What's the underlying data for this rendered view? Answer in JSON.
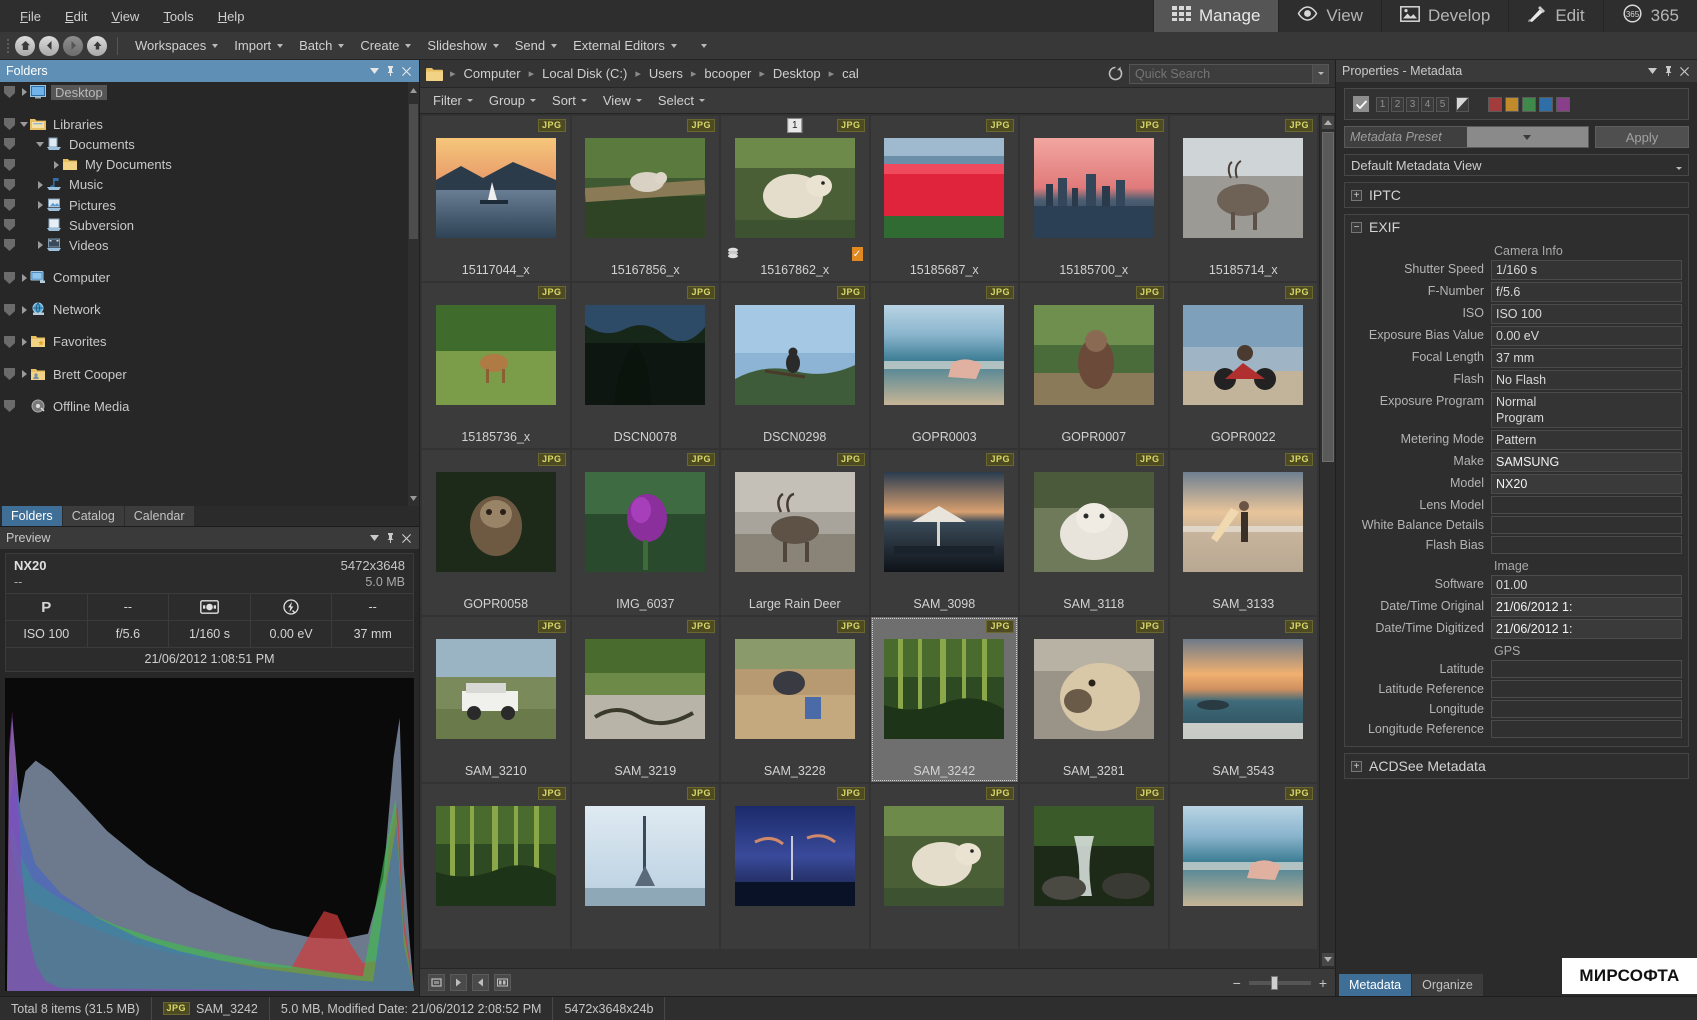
{
  "menu": {
    "items": [
      "File",
      "Edit",
      "View",
      "Tools",
      "Help"
    ]
  },
  "modes": [
    {
      "label": "Manage",
      "icon": "grid-icon",
      "active": true
    },
    {
      "label": "View",
      "icon": "eye-icon",
      "active": false
    },
    {
      "label": "Develop",
      "icon": "picture-icon",
      "active": false
    },
    {
      "label": "Edit",
      "icon": "brush-icon",
      "active": false
    },
    {
      "label": "365",
      "icon": "365-icon",
      "active": false
    }
  ],
  "toolbar": {
    "nav": [
      "home-icon",
      "back-icon",
      "forward-icon",
      "up-icon"
    ],
    "items": [
      "Workspaces",
      "Import",
      "Batch",
      "Create",
      "Slideshow",
      "Send",
      "External Editors"
    ]
  },
  "folders_panel": {
    "title": "Folders",
    "tree": [
      {
        "label": "Desktop",
        "depth": 1,
        "icon": "desktop-icon",
        "expander": "right",
        "selected": true
      },
      {
        "label": "",
        "depth": 0,
        "icon": "none",
        "expander": "none",
        "spacer": true
      },
      {
        "label": "Libraries",
        "depth": 1,
        "icon": "libraries-icon",
        "expander": "down"
      },
      {
        "label": "Documents",
        "depth": 2,
        "icon": "documents-icon",
        "expander": "down"
      },
      {
        "label": "My Documents",
        "depth": 3,
        "icon": "folder-icon",
        "expander": "right"
      },
      {
        "label": "Music",
        "depth": 2,
        "icon": "music-icon",
        "expander": "right"
      },
      {
        "label": "Pictures",
        "depth": 2,
        "icon": "pictures-icon",
        "expander": "right"
      },
      {
        "label": "Subversion",
        "depth": 2,
        "icon": "subversion-icon",
        "expander": "none"
      },
      {
        "label": "Videos",
        "depth": 2,
        "icon": "videos-icon",
        "expander": "right"
      },
      {
        "label": "",
        "depth": 0,
        "icon": "none",
        "expander": "none",
        "spacer": true
      },
      {
        "label": "Computer",
        "depth": 1,
        "icon": "computer-icon",
        "expander": "right"
      },
      {
        "label": "",
        "depth": 0,
        "icon": "none",
        "expander": "none",
        "spacer": true
      },
      {
        "label": "Network",
        "depth": 1,
        "icon": "network-icon",
        "expander": "right"
      },
      {
        "label": "",
        "depth": 0,
        "icon": "none",
        "expander": "none",
        "spacer": true
      },
      {
        "label": "Favorites",
        "depth": 1,
        "icon": "favorites-icon",
        "expander": "right"
      },
      {
        "label": "",
        "depth": 0,
        "icon": "none",
        "expander": "none",
        "spacer": true
      },
      {
        "label": "Brett Cooper",
        "depth": 1,
        "icon": "user-folder-icon",
        "expander": "right"
      },
      {
        "label": "",
        "depth": 0,
        "icon": "none",
        "expander": "none",
        "spacer": true
      },
      {
        "label": "Offline Media",
        "depth": 1,
        "icon": "offline-media-icon",
        "expander": "none"
      }
    ],
    "tabs": [
      {
        "label": "Folders",
        "active": true
      },
      {
        "label": "Catalog",
        "active": false
      },
      {
        "label": "Calendar",
        "active": false
      }
    ]
  },
  "preview_panel": {
    "title": "Preview",
    "camera": "NX20",
    "dimensions": "5472x3648",
    "lens": "--",
    "filesize": "5.0 MB",
    "icon_row": [
      "P",
      "--",
      "metering-icon",
      "flash-off-icon",
      "--"
    ],
    "value_row": [
      "ISO 100",
      "f/5.6",
      "1/160 s",
      "0.00 eV",
      "37 mm"
    ],
    "date": "21/06/2012 1:08:51 PM"
  },
  "breadcrumb": {
    "folder_icon": "folder-icon",
    "path": [
      "Computer",
      "Local Disk (C:)",
      "Users",
      "bcooper",
      "Desktop",
      "cal"
    ]
  },
  "search": {
    "refresh_icon": "refresh-icon",
    "placeholder": "Quick Search",
    "value": ""
  },
  "filterbar": {
    "items": [
      "Filter",
      "Group",
      "Sort",
      "View",
      "Select"
    ]
  },
  "grid": {
    "items": [
      {
        "name": "15117044_x",
        "format": "JPG",
        "scene": "sailboat-lake",
        "selected": false
      },
      {
        "name": "15167856_x",
        "format": "JPG",
        "scene": "bear-log",
        "selected": false
      },
      {
        "name": "15167862_x",
        "format": "JPG",
        "scene": "bear-grass",
        "selected": false,
        "number_badge": "1",
        "stack_badge": true,
        "orange_badge": true
      },
      {
        "name": "15185687_x",
        "format": "JPG",
        "scene": "tulip-field",
        "selected": false
      },
      {
        "name": "15185700_x",
        "format": "JPG",
        "scene": "city-sunset",
        "selected": false
      },
      {
        "name": "15185714_x",
        "format": "JPG",
        "scene": "caribou",
        "selected": false
      },
      {
        "name": "15185736_x",
        "format": "JPG",
        "scene": "deer-meadow",
        "selected": false
      },
      {
        "name": "DSCN0078",
        "format": "JPG",
        "scene": "dark-tree",
        "selected": false
      },
      {
        "name": "DSCN0298",
        "format": "JPG",
        "scene": "bird-branch",
        "selected": false
      },
      {
        "name": "GOPR0003",
        "format": "JPG",
        "scene": "beach-surf",
        "selected": false
      },
      {
        "name": "GOPR0007",
        "format": "JPG",
        "scene": "jungle-path",
        "selected": false
      },
      {
        "name": "GOPR0022",
        "format": "JPG",
        "scene": "motorbike",
        "selected": false
      },
      {
        "name": "GOPR0058",
        "format": "JPG",
        "scene": "sloth",
        "selected": false
      },
      {
        "name": "IMG_6037",
        "format": "JPG",
        "scene": "purple-flower",
        "selected": false
      },
      {
        "name": "Large Rain Deer",
        "format": "JPG",
        "scene": "reindeer",
        "selected": false
      },
      {
        "name": "SAM_3098",
        "format": "JPG",
        "scene": "patio-umbrella",
        "selected": false
      },
      {
        "name": "SAM_3118",
        "format": "JPG",
        "scene": "white-dog",
        "selected": false
      },
      {
        "name": "SAM_3133",
        "format": "JPG",
        "scene": "surfer-beach",
        "selected": false
      },
      {
        "name": "SAM_3210",
        "format": "JPG",
        "scene": "jeep-palms",
        "selected": false
      },
      {
        "name": "SAM_3219",
        "format": "JPG",
        "scene": "snake-path",
        "selected": false
      },
      {
        "name": "SAM_3228",
        "format": "JPG",
        "scene": "deck-work",
        "selected": false
      },
      {
        "name": "SAM_3242",
        "format": "JPG",
        "scene": "bamboo-forest",
        "selected": true
      },
      {
        "name": "SAM_3281",
        "format": "JPG",
        "scene": "dog-closeup",
        "selected": false
      },
      {
        "name": "SAM_3543",
        "format": "JPG",
        "scene": "ocean-sunset",
        "selected": false
      },
      {
        "name": "",
        "format": "JPG",
        "scene": "bamboo-forest",
        "selected": false
      },
      {
        "name": "",
        "format": "JPG",
        "scene": "tower-sky",
        "selected": false
      },
      {
        "name": "",
        "format": "JPG",
        "scene": "night-boat",
        "selected": false
      },
      {
        "name": "",
        "format": "JPG",
        "scene": "bear-grass",
        "selected": false
      },
      {
        "name": "",
        "format": "JPG",
        "scene": "waterfall-rocks",
        "selected": false
      },
      {
        "name": "",
        "format": "JPG",
        "scene": "beach-surf",
        "selected": false
      }
    ]
  },
  "browsebar": {
    "zoom_out": "−",
    "zoom_in": "+"
  },
  "properties": {
    "title": "Properties - Metadata",
    "ratings": [
      "1",
      "2",
      "3",
      "4",
      "5"
    ],
    "color_labels": [
      "#a33d3d",
      "#c08a2a",
      "#3f8a4a",
      "#2f6fa8",
      "#8a3f8a"
    ],
    "preset_placeholder": "Metadata Preset",
    "apply_label": "Apply",
    "view_label": "Default Metadata View",
    "sections": [
      {
        "id": "iptc",
        "label": "IPTC",
        "expanded": false
      },
      {
        "id": "exif",
        "label": "EXIF",
        "expanded": true
      },
      {
        "id": "acdsee",
        "label": "ACDSee Metadata",
        "expanded": false
      }
    ],
    "exif_groups": [
      {
        "group": "Camera Info",
        "fields": [
          {
            "label": "Shutter Speed",
            "value": "1/160 s",
            "bright": false
          },
          {
            "label": "F-Number",
            "value": "f/5.6",
            "bright": false
          },
          {
            "label": "ISO",
            "value": "ISO 100",
            "bright": false
          },
          {
            "label": "Exposure Bias Value",
            "value": "0.00 eV",
            "bright": false
          },
          {
            "label": "Focal Length",
            "value": "37 mm",
            "bright": false
          },
          {
            "label": "Flash",
            "value": "No Flash",
            "bright": false
          },
          {
            "label": "Exposure Program",
            "value": "Normal\nProgram",
            "bright": false
          },
          {
            "label": "Metering Mode",
            "value": "Pattern",
            "bright": false
          },
          {
            "label": "Make",
            "value": "SAMSUNG",
            "bright": true
          },
          {
            "label": "Model",
            "value": "NX20",
            "bright": true
          },
          {
            "label": "Lens Model",
            "value": "",
            "bright": false
          },
          {
            "label": "White Balance Details",
            "value": "",
            "bright": false
          },
          {
            "label": "Flash Bias",
            "value": "",
            "bright": false
          }
        ]
      },
      {
        "group": "Image",
        "fields": [
          {
            "label": "Software",
            "value": "01.00",
            "bright": false
          },
          {
            "label": "Date/Time Original",
            "value": "21/06/2012 1:",
            "bright": true
          },
          {
            "label": "Date/Time Digitized",
            "value": "21/06/2012 1:",
            "bright": true
          }
        ]
      },
      {
        "group": "GPS",
        "fields": [
          {
            "label": "Latitude",
            "value": "",
            "bright": false
          },
          {
            "label": "Latitude Reference",
            "value": "",
            "bright": false
          },
          {
            "label": "Longitude",
            "value": "",
            "bright": false
          },
          {
            "label": "Longitude Reference",
            "value": "",
            "bright": false
          }
        ]
      }
    ],
    "tabs": [
      {
        "label": "Metadata",
        "active": true
      },
      {
        "label": "Organize",
        "active": false
      }
    ]
  },
  "statusbar": {
    "total": "Total 8 items  (31.5 MB)",
    "format_badge": "JPG",
    "filename": "SAM_3242",
    "details": "5.0 MB, Modified Date: 21/06/2012 2:08:52 PM",
    "dimensions": "5472x3648x24b"
  },
  "watermark": {
    "text": "МИРСОФТА"
  },
  "colors": {
    "accent": "#3f6f97",
    "panel_header": "#5f8fb5",
    "background": "#333333",
    "jpg_badge": "#d8d86a"
  }
}
